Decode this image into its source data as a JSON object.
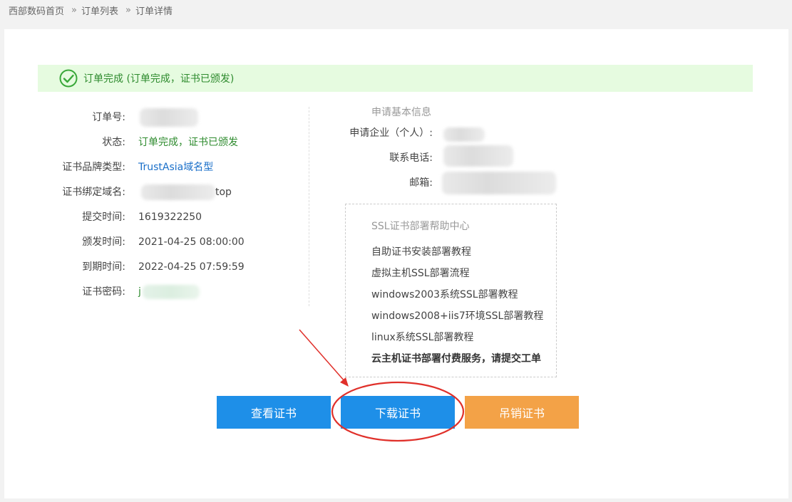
{
  "breadcrumb": {
    "items": [
      "西部数码首页",
      "订单列表",
      "订单详情"
    ],
    "separator": "»"
  },
  "status_banner": {
    "text": "订单完成 (订单完成，证书已颁发)",
    "color": "#2e8b2e"
  },
  "order_info": {
    "order_no_label": "订单号:",
    "status_label": "状态:",
    "status_value": "订单完成，证书已颁发",
    "brand_label": "证书品牌类型:",
    "brand_value": "TrustAsia域名型",
    "domain_label": "证书绑定域名:",
    "domain_suffix": "top",
    "submit_time_label": "提交时间:",
    "submit_time_value": "1619322250",
    "issue_time_label": "颁发时间:",
    "issue_time_value": "2021-04-25 08:00:00",
    "expire_time_label": "到期时间:",
    "expire_time_value": "2022-04-25 07:59:59",
    "password_label": "证书密码:",
    "password_prefix": "j"
  },
  "applicant_info": {
    "title": "申请基本信息",
    "company_label": "申请企业（个人）:",
    "phone_label": "联系电话:",
    "email_label": "邮箱:"
  },
  "help_center": {
    "title": "SSL证书部署帮助中心",
    "links": [
      "自助证书安装部署教程",
      "虚拟主机SSL部署流程",
      "windows2003系统SSL部署教程",
      "windows2008+iis7环境SSL部署教程",
      "linux系统SSL部署教程",
      "云主机证书部署付费服务，请提交工单"
    ]
  },
  "buttons": {
    "view_label": "查看证书",
    "download_label": "下载证书",
    "revoke_label": "吊销证书"
  },
  "colors": {
    "primary": "#1e8fe8",
    "warning": "#f3a247",
    "success_bg": "#e6fbe0",
    "link_blue": "#1a6fc9",
    "annotation_red": "#e0302a"
  }
}
